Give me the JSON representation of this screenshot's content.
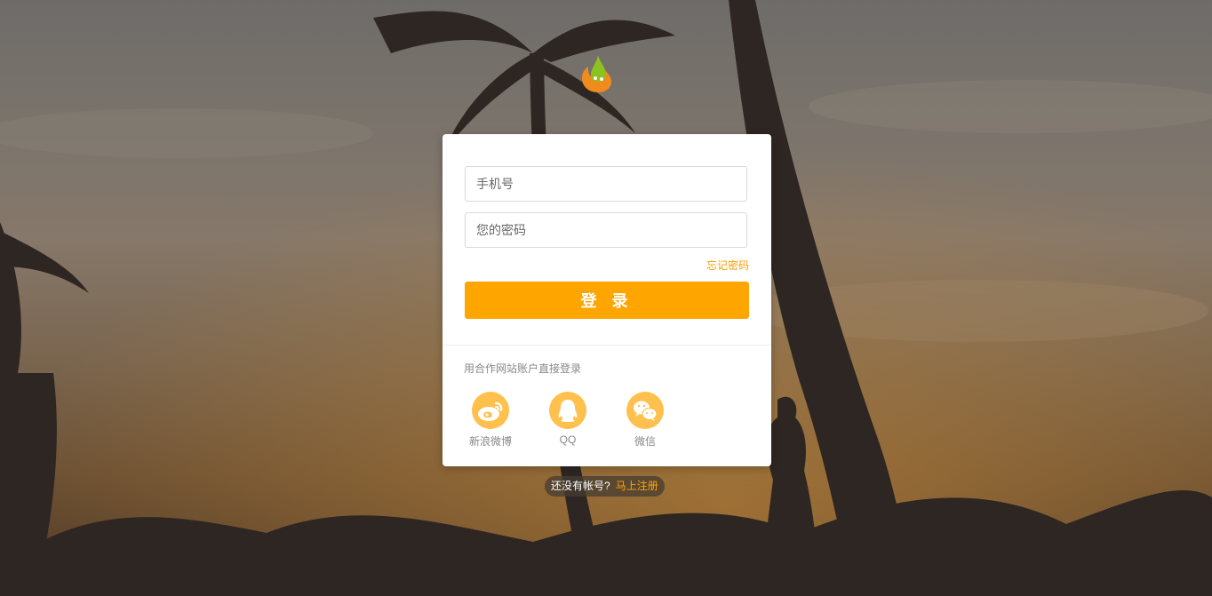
{
  "login": {
    "phone_placeholder": "手机号",
    "password_placeholder": "您的密码",
    "forgot_password": "忘记密码",
    "submit_label": "登 录"
  },
  "partner": {
    "title": "用合作网站账户直接登录",
    "providers": [
      {
        "label": "新浪微博",
        "icon": "weibo-icon"
      },
      {
        "label": "QQ",
        "icon": "qq-icon"
      },
      {
        "label": "微信",
        "icon": "wechat-icon"
      }
    ]
  },
  "register": {
    "question": "还没有帐号?",
    "link": "马上注册"
  },
  "colors": {
    "accent": "#ffa500",
    "social_bg": "#ffc04d",
    "link": "#f5a000"
  }
}
